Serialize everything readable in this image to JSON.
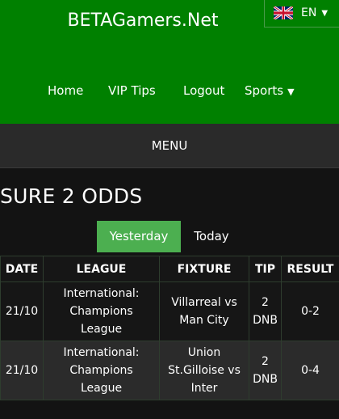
{
  "header": {
    "site_title": "BETAGamers.Net",
    "language": {
      "label": "EN",
      "flag": "uk-flag-icon"
    }
  },
  "nav": {
    "items": [
      "Home",
      "VIP Tips",
      "Logout",
      "Sports"
    ]
  },
  "menu_bar": {
    "label": "MENU"
  },
  "main": {
    "title": "SURE 2 ODDS",
    "tabs": [
      {
        "label": "Yesterday",
        "active": true
      },
      {
        "label": "Today",
        "active": false
      }
    ],
    "table": {
      "headers": [
        "DATE",
        "LEAGUE",
        "FIXTURE",
        "TIP",
        "RESULT"
      ],
      "rows": [
        {
          "date": "21/10",
          "league": [
            "International:",
            "Champions",
            "League"
          ],
          "fixture": [
            "Villarreal vs",
            "Man City"
          ],
          "tip": [
            "2",
            "DNB"
          ],
          "result": "0-2"
        },
        {
          "date": "21/10",
          "league": [
            "International:",
            "Champions",
            "League"
          ],
          "fixture": [
            "Union",
            "St.Gilloise vs",
            "Inter"
          ],
          "tip": [
            "2",
            "DNB"
          ],
          "result": "0-4"
        }
      ]
    }
  },
  "colors": {
    "header_bg": "#008000",
    "menu_bg": "#2a2a2a",
    "page_bg": "#131313",
    "active_tab": "#4caf50"
  }
}
